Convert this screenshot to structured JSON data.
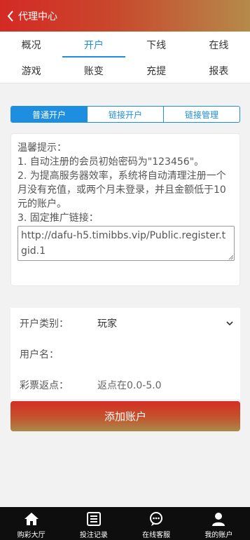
{
  "header": {
    "title": "代理中心"
  },
  "tabs": {
    "row1": [
      {
        "label": "概况",
        "active": false
      },
      {
        "label": "开户",
        "active": true
      },
      {
        "label": "下线",
        "active": false
      },
      {
        "label": "在线",
        "active": false
      }
    ],
    "row2": [
      {
        "label": "游戏"
      },
      {
        "label": "账变"
      },
      {
        "label": "充提"
      },
      {
        "label": "报表"
      }
    ]
  },
  "segments": [
    {
      "label": "普通开户",
      "active": true
    },
    {
      "label": "链接开户",
      "active": false
    },
    {
      "label": "链接管理",
      "active": false
    }
  ],
  "notice": {
    "title": "温馨提示：",
    "line1": "1. 自动注册的会员初始密码为\"123456\"。",
    "line2": "2. 为提高服务器效率，系统将自动清理注册一个月没有充值，或两个月未登录，并且金额低于10元的账户。",
    "line3": "3. 固定推广链接：",
    "link": "http://dafu-h5.timibbs.vip/Public.register.tgid.1"
  },
  "form": {
    "type_label": "开户类别：",
    "type_value": "玩家",
    "username_label": "用户名：",
    "username_value": "",
    "rebate_label": "彩票返点：",
    "rebate_value": "返点在0.0-5.0"
  },
  "submit_label": "添加账户",
  "bottom_nav": [
    {
      "label": "购彩大厅",
      "icon": "home-icon"
    },
    {
      "label": "投注记录",
      "icon": "list-icon"
    },
    {
      "label": "在线客服",
      "icon": "chat-icon"
    },
    {
      "label": "我的账户",
      "icon": "user-icon"
    }
  ],
  "colors": {
    "accent": "#1e8fe0",
    "brand_red": "#d42a24",
    "brand_gold": "#b58a4a"
  }
}
